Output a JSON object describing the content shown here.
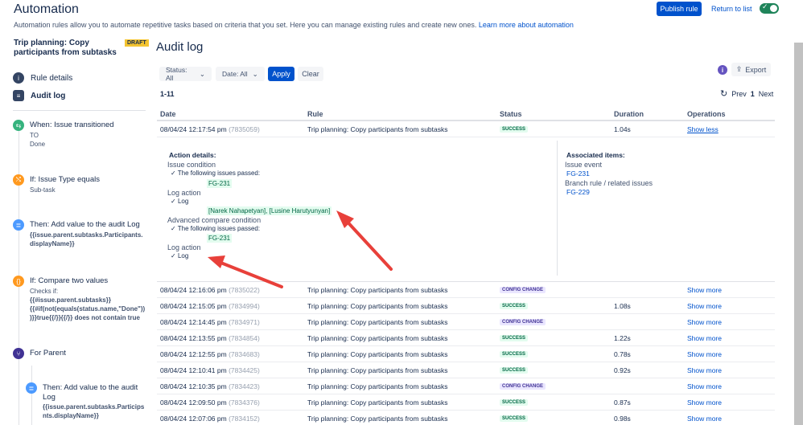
{
  "header": {
    "title": "Automation",
    "subtitle": "Automation rules allow you to automate repetitive tasks based on criteria that you set. Here you can manage existing rules and create new ones.",
    "learn_more": "Learn more about automation",
    "publish_label": "Publish rule",
    "return_label": "Return to list",
    "toggle_on": true,
    "toggle_check": "✓"
  },
  "rule": {
    "name": "Trip planning: Copy participants from subtasks",
    "badge": "DRAFT"
  },
  "nav": {
    "details_label": "Rule details",
    "audit_label": "Audit log"
  },
  "steps": {
    "trigger_title": "When: Issue transitioned",
    "trigger_to": "TO",
    "trigger_status": "Done",
    "cond_title": "If: Issue Type equals",
    "cond_value": "Sub-task",
    "action1_title": "Then: Add value to the audit Log",
    "action1_l1": "{{issue.parent.subtasks.Participants.",
    "action1_l2": "displayName}}",
    "compare_title": "If: Compare two values",
    "compare_checks": "Checks if:",
    "compare_l1": "{{#issue.parent.subtasks}}",
    "compare_l2": "{{#if(not(equals(status.name,\"Done\"))",
    "compare_l3": ")}}true{{/}}{{/}} does not contain true",
    "branch_title": "For Parent",
    "action2_title": "Then: Add value to the audit",
    "action2_title2": "Log",
    "action2_l1": "{{issue.parent.subtasks.Particips",
    "action2_l2": "nts.displayName}}"
  },
  "main": {
    "title": "Audit log",
    "filter_status": "Status: All",
    "filter_date": "Date: All",
    "apply": "Apply",
    "clear": "Clear",
    "info": "i",
    "export": "Export",
    "range": "1-11",
    "prev": "Prev",
    "page": "1",
    "next": "Next"
  },
  "table": {
    "columns": [
      "Date",
      "Rule",
      "Status",
      "Duration",
      "Operations"
    ],
    "rows": [
      {
        "date": "08/04/24 12:17:54 pm",
        "id": "(7835059)",
        "rule": "Trip planning: Copy participants from subtasks",
        "status": "SUCCESS",
        "duration": "1.04s",
        "op": "Show less"
      },
      {
        "date": "08/04/24 12:16:06 pm",
        "id": "(7835022)",
        "rule": "Trip planning: Copy participants from subtasks",
        "status": "CONFIG CHANGE",
        "duration": "",
        "op": "Show more"
      },
      {
        "date": "08/04/24 12:15:05 pm",
        "id": "(7834994)",
        "rule": "Trip planning: Copy participants from subtasks",
        "status": "SUCCESS",
        "duration": "1.08s",
        "op": "Show more"
      },
      {
        "date": "08/04/24 12:14:45 pm",
        "id": "(7834971)",
        "rule": "Trip planning: Copy participants from subtasks",
        "status": "CONFIG CHANGE",
        "duration": "",
        "op": "Show more"
      },
      {
        "date": "08/04/24 12:13:55 pm",
        "id": "(7834854)",
        "rule": "Trip planning: Copy participants from subtasks",
        "status": "SUCCESS",
        "duration": "1.22s",
        "op": "Show more"
      },
      {
        "date": "08/04/24 12:12:55 pm",
        "id": "(7834683)",
        "rule": "Trip planning: Copy participants from subtasks",
        "status": "SUCCESS",
        "duration": "0.78s",
        "op": "Show more"
      },
      {
        "date": "08/04/24 12:10:41 pm",
        "id": "(7834425)",
        "rule": "Trip planning: Copy participants from subtasks",
        "status": "SUCCESS",
        "duration": "0.92s",
        "op": "Show more"
      },
      {
        "date": "08/04/24 12:10:35 pm",
        "id": "(7834423)",
        "rule": "Trip planning: Copy participants from subtasks",
        "status": "CONFIG CHANGE",
        "duration": "",
        "op": "Show more"
      },
      {
        "date": "08/04/24 12:09:50 pm",
        "id": "(7834376)",
        "rule": "Trip planning: Copy participants from subtasks",
        "status": "SUCCESS",
        "duration": "0.87s",
        "op": "Show more"
      },
      {
        "date": "08/04/24 12:07:06 pm",
        "id": "(7834152)",
        "rule": "Trip planning: Copy participants from subtasks",
        "status": "SUCCESS",
        "duration": "0.98s",
        "op": "Show more"
      }
    ]
  },
  "details": {
    "action_header": "Action details:",
    "issue_condition": "Issue condition",
    "passed1": "The following issues passed:",
    "passed1_issue": "FG-231",
    "log_action1": "Log action",
    "log1": "Log",
    "log_value": "[Narek Nahapetyan], [Lusine Harutyunyan]",
    "adv_compare": "Advanced compare condition",
    "passed2": "The following issues passed:",
    "passed2_issue": "FG-231",
    "log_action2": "Log action",
    "log2": "Log",
    "assoc_header": "Associated items:",
    "issue_event": "Issue event",
    "issue_event_link": "FG-231",
    "branch_rule": "Branch rule / related issues",
    "branch_link": "FG-229"
  },
  "colors": {
    "primary": "#0052cc",
    "success": "#006644",
    "config": "#403294",
    "arrow": "#e8403a"
  }
}
